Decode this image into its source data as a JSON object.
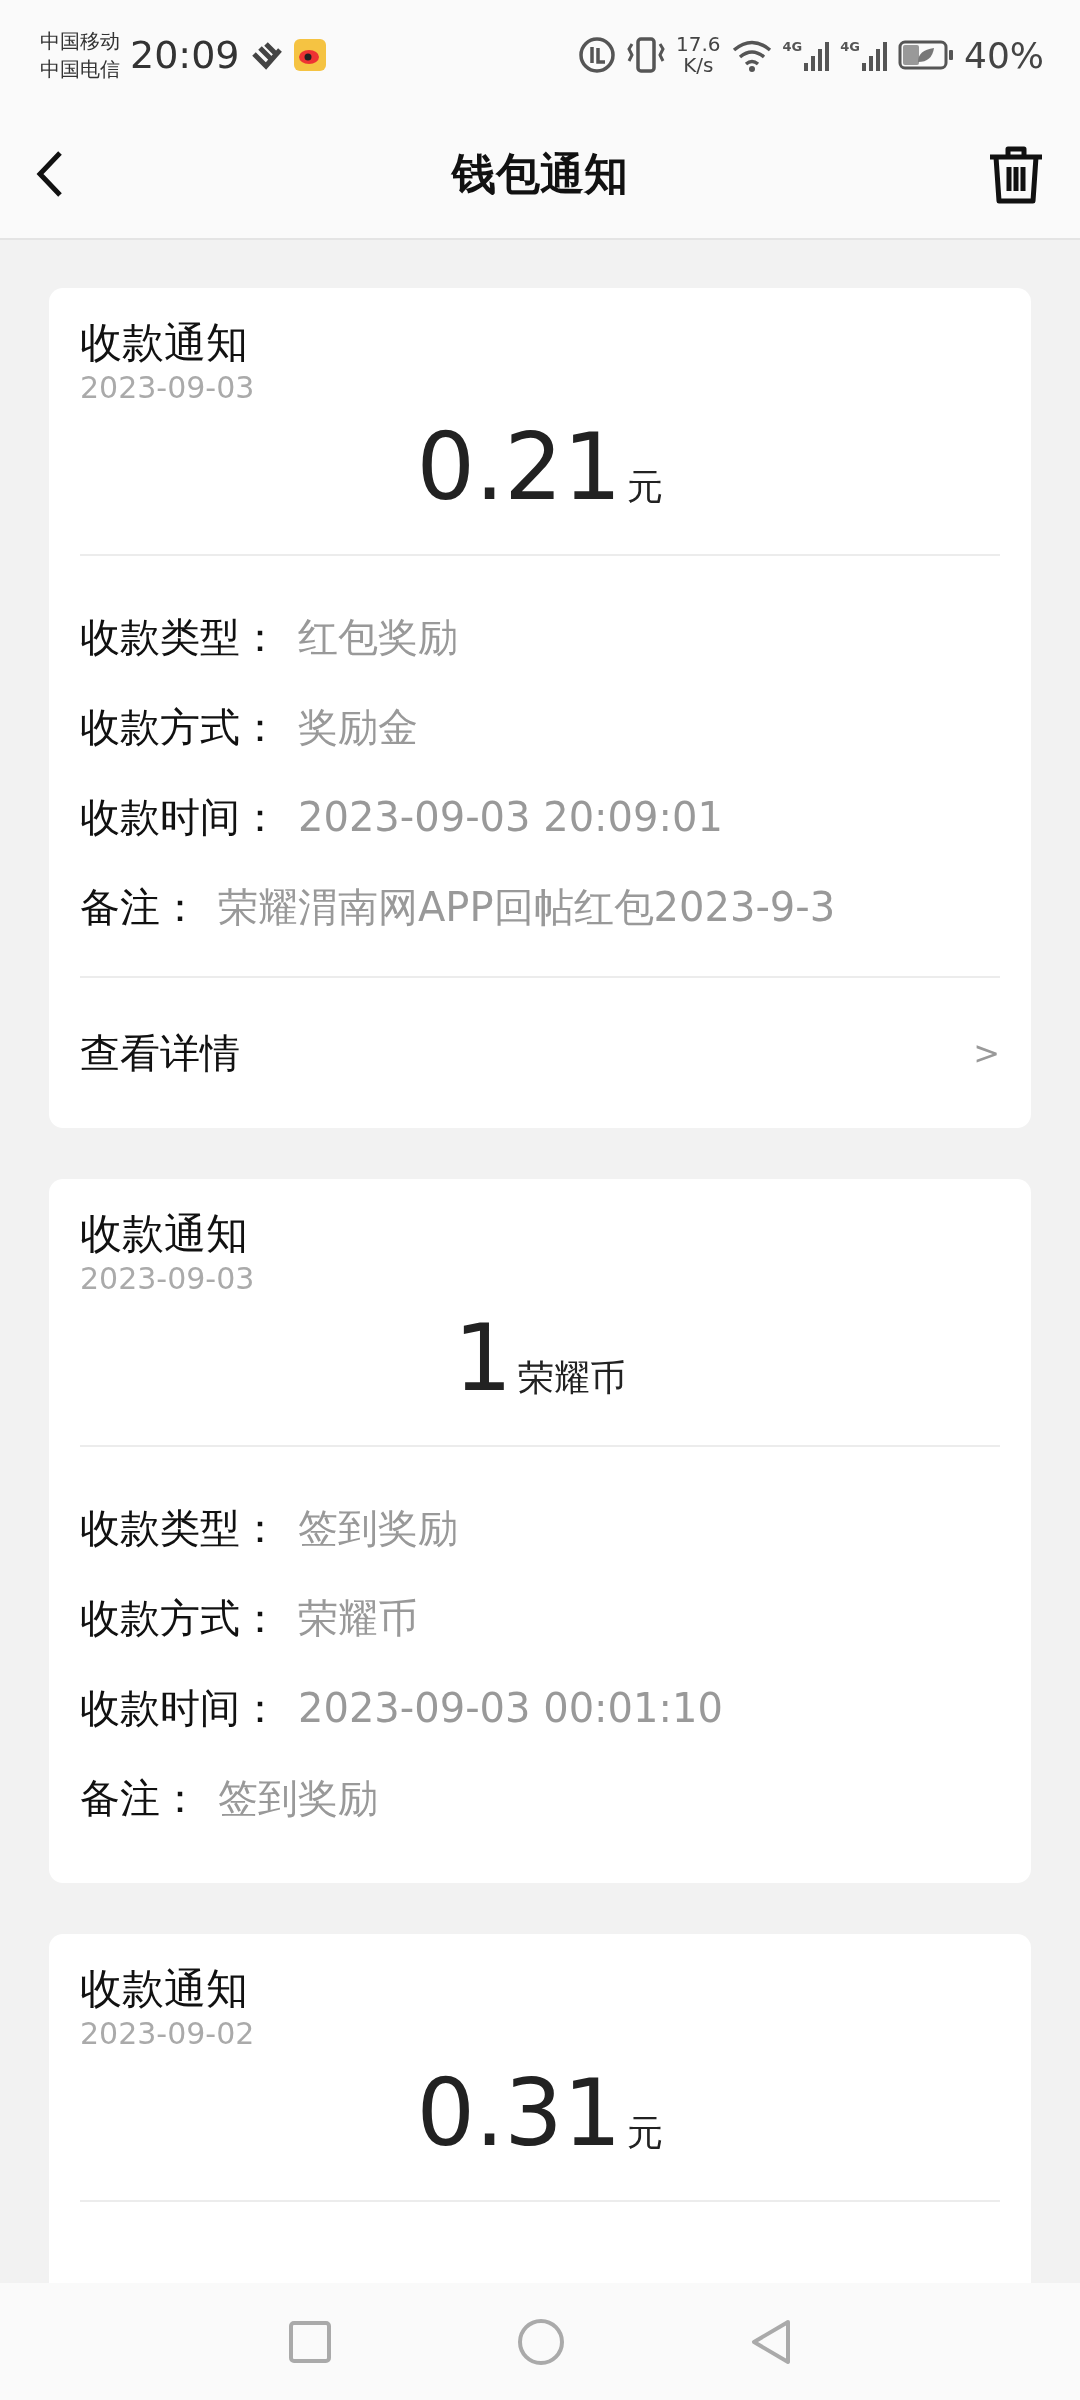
{
  "status_bar": {
    "carriers": [
      "中国移动",
      "中国电信"
    ],
    "time": "20:09",
    "speed": "17.6",
    "speed_unit": "K/s",
    "networks": [
      "4G",
      "4G"
    ],
    "battery": "40%"
  },
  "header": {
    "title": "钱包通知"
  },
  "notifications": [
    {
      "title": "收款通知",
      "date": "2023-09-03",
      "amount": "0.21",
      "unit": "元",
      "fields": [
        {
          "label": "收款类型：",
          "value": "红包奖励"
        },
        {
          "label": "收款方式：",
          "value": "奖励金"
        },
        {
          "label": "收款时间：",
          "value": "2023-09-03 20:09:01"
        },
        {
          "label": "备注：",
          "value": "荣耀渭南网APP回帖红包2023-9-3"
        }
      ],
      "details": {
        "label": "查看详情",
        "arrow": ">"
      }
    },
    {
      "title": "收款通知",
      "date": "2023-09-03",
      "amount": "1",
      "unit": "荣耀币",
      "fields": [
        {
          "label": "收款类型：",
          "value": "签到奖励"
        },
        {
          "label": "收款方式：",
          "value": "荣耀币"
        },
        {
          "label": "收款时间：",
          "value": "2023-09-03 00:01:10"
        },
        {
          "label": "备注：",
          "value": "签到奖励"
        }
      ]
    },
    {
      "title": "收款通知",
      "date": "2023-09-02",
      "amount": "0.31",
      "unit": "元"
    }
  ]
}
